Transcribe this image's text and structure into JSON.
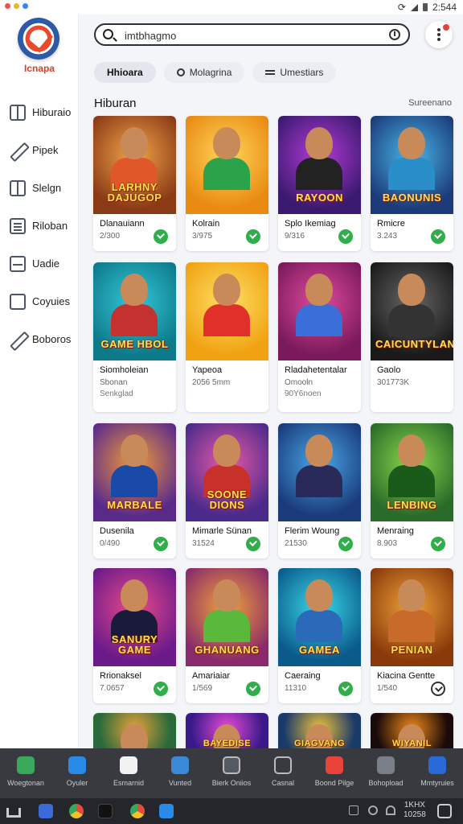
{
  "status_bar": {
    "time": "2:544",
    "dot_colors": [
      "#e25555",
      "#f0b429",
      "#3b82f6"
    ]
  },
  "sidebar": {
    "brand": "Icnapa",
    "items": [
      {
        "label": "Hiburaio",
        "icon": "grid-icon"
      },
      {
        "label": "Pipek",
        "icon": "pen-icon"
      },
      {
        "label": "Slelgn",
        "icon": "split-icon"
      },
      {
        "label": "Riloban",
        "icon": "list-icon"
      },
      {
        "label": "Uadie",
        "icon": "inbox-icon"
      },
      {
        "label": "Coyuies",
        "icon": "note-icon"
      },
      {
        "label": "Boboros",
        "icon": "pen-icon"
      }
    ]
  },
  "search": {
    "value": "imtbhagmo",
    "placeholder": "imtbhagmo"
  },
  "chips": [
    {
      "label": "Hhioara",
      "active": true
    },
    {
      "label": "Molagrina",
      "active": false
    },
    {
      "label": "Umestiars",
      "active": false
    }
  ],
  "section": {
    "title": "Hiburan",
    "link": "Sureenano"
  },
  "cards": [
    {
      "name": "Dlanauiann",
      "sub": "2/300",
      "art": "LARHNY DAJUGOP",
      "colors": [
        "#8a3b16",
        "#f3a54a"
      ],
      "shirt": "#e0582a",
      "check": "filled"
    },
    {
      "name": "Kolrain",
      "sub": "3/975",
      "art": "",
      "colors": [
        "#e98a12",
        "#ffd65a"
      ],
      "shirt": "#2ca34a",
      "check": "filled"
    },
    {
      "name": "Splo Ikemiag",
      "sub": "9/316",
      "art": "RAYOON",
      "colors": [
        "#3a1a6e",
        "#b43ad8"
      ],
      "shirt": "#222",
      "check": "filled"
    },
    {
      "name": "Rmicre",
      "sub": "3.243",
      "art": "BAONUNIS",
      "colors": [
        "#1c3b7a",
        "#48b7e8"
      ],
      "shirt": "#2a8fc8",
      "check": "filled"
    },
    {
      "name": "Siomholeian",
      "sub": "Sbonan",
      "sub2": "Senkglad",
      "art": "GAME HBOL",
      "colors": [
        "#0d7a8a",
        "#35c7d9"
      ],
      "shirt": "#c3322e",
      "check": "none"
    },
    {
      "name": "Yapeoa",
      "sub": "2056 5mm",
      "art": "",
      "colors": [
        "#f0a212",
        "#ffe066"
      ],
      "shirt": "#e0302a",
      "check": "none"
    },
    {
      "name": "Rladahetentalar",
      "sub": "Omooln",
      "sub2": "90Y6noen",
      "art": "",
      "colors": [
        "#7a1a5a",
        "#e24aa0"
      ],
      "shirt": "#3a6fd8",
      "check": "none"
    },
    {
      "name": "Gaolo",
      "sub": "301773K",
      "art": "CAICUNTYLAN",
      "colors": [
        "#1a1a1a",
        "#666666"
      ],
      "shirt": "#333",
      "check": "none"
    },
    {
      "name": "Dusenila",
      "sub": "0/490",
      "art": "MARBALE",
      "colors": [
        "#5a2a8a",
        "#f29a3a"
      ],
      "shirt": "#1a4aa8",
      "check": "filled"
    },
    {
      "name": "Mimarle Sünan",
      "sub": "31524",
      "art": "SOONE DIONS",
      "colors": [
        "#4a2a8a",
        "#e85aa8"
      ],
      "shirt": "#c8302a",
      "check": "filled"
    },
    {
      "name": "Flerim Woung",
      "sub": "21530",
      "art": "",
      "colors": [
        "#1a3a7a",
        "#4aa8e8"
      ],
      "shirt": "#2a2a5a",
      "check": "filled"
    },
    {
      "name": "Menraing",
      "sub": "8.903",
      "art": "LENBING",
      "colors": [
        "#2a6a2a",
        "#8ad84a"
      ],
      "shirt": "#1a5a1a",
      "check": "filled"
    },
    {
      "name": "Rrionaksel",
      "sub": "7.0657",
      "art": "SANURY GAME",
      "colors": [
        "#6a1a8a",
        "#e84a8a"
      ],
      "shirt": "#1a1a3a",
      "check": "filled"
    },
    {
      "name": "Amariaiar",
      "sub": "1/569",
      "art": "GHANUANG",
      "colors": [
        "#8a2a6a",
        "#f0a23a"
      ],
      "shirt": "#5ab83a",
      "check": "filled"
    },
    {
      "name": "Caeraing",
      "sub": "11310",
      "art": "GAMEA",
      "colors": [
        "#0a5a8a",
        "#3ad8e8"
      ],
      "shirt": "#2a6ab8",
      "check": "filled"
    },
    {
      "name": "Kiacina Gentte",
      "sub": "1/540",
      "art": "PENIAN",
      "colors": [
        "#8a3a0a",
        "#f0a23a"
      ],
      "shirt": "#c86a2a",
      "check": "outline"
    },
    {
      "name": "",
      "sub": "",
      "art": "",
      "colors": [
        "#2a6a3a",
        "#e8a23a"
      ],
      "shirt": "#2a4a8a",
      "check": "none"
    },
    {
      "name": "",
      "sub": "",
      "art": "BAYEDISE",
      "colors": [
        "#3a1a8a",
        "#e84ad8"
      ],
      "shirt": "#3a1a8a",
      "check": "none"
    },
    {
      "name": "",
      "sub": "",
      "art": "GIAGVANG",
      "colors": [
        "#1a3a6a",
        "#f0c23a"
      ],
      "shirt": "#1a3a6a",
      "check": "none"
    },
    {
      "name": "",
      "sub": "",
      "art": "WIYANIL",
      "colors": [
        "#1a0a0a",
        "#f08a1a"
      ],
      "shirt": "#1a0a0a",
      "check": "none"
    }
  ],
  "dock": [
    {
      "label": "Woegtonan",
      "color": "#3aa85a"
    },
    {
      "label": "Oyuler",
      "color": "#2a8ae8"
    },
    {
      "label": "Esmarnid",
      "color": "#f2f2f2"
    },
    {
      "label": "Vunted",
      "color": "#3a8ad8"
    },
    {
      "label": "Bierk Oniios",
      "color": "#555a62"
    },
    {
      "label": "Casnal",
      "color": "#383a40"
    },
    {
      "label": "Boond Pilge",
      "color": "#e8443a"
    },
    {
      "label": "Bohopload",
      "color": "#7a7e88"
    },
    {
      "label": "Mmtyruies",
      "color": "#2a6ad8"
    }
  ],
  "system_bar": {
    "time": "1KHX",
    "date": "10258"
  }
}
